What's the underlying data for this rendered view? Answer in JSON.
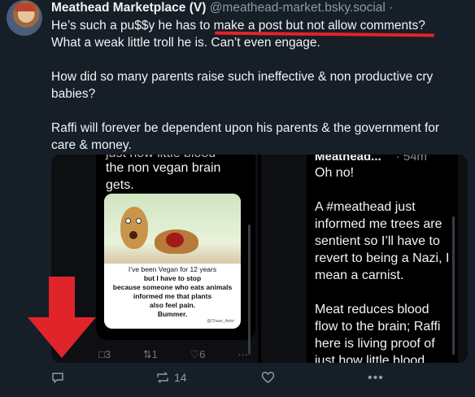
{
  "post": {
    "author_name": "Meathead Marketplace (V)",
    "author_handle": "@meathead-market.bsky.social",
    "separator": "·",
    "text_line1_a": "He’s such a pu$$y he has to ",
    "text_line1_b": "make a post but not allow comments",
    "text_line1_c": "?",
    "text_line2": "What a weak little troll he is. Can’t even engage.",
    "text_para2": "How did so many parents raise such ineffective & non productive cry babies?",
    "text_para3": "Raffi will forever be dependent upon his parents & the government for care & money."
  },
  "images": {
    "left": {
      "top_partial": "just how little blood",
      "line1": "the non vegan brain",
      "line2": "gets.",
      "card_caption1": "I’ve been Vegan for 12 years",
      "card_caption2": "but I have to stop",
      "card_caption3": "because someone who eats animals",
      "card_caption4": "informed me that plants",
      "card_caption5": "also feel pain.",
      "card_caption6": "Bummer.",
      "card_credit": "@Chase_Avior",
      "actions": {
        "reply_count": "3",
        "repost_count": "1",
        "like_count": "6",
        "more": "···"
      }
    },
    "right": {
      "name": "Meathead...",
      "time": "· 54m",
      "p1": "Oh no!",
      "p2": "A #meathead just informed me trees are sentient so I’ll have to revert to being a Nazi, I mean a carnist.",
      "p3": "Meat reduces blood flow to the brain; Raffi here is living proof of just how little blood"
    }
  },
  "actions": {
    "reply_count": "",
    "repost_count": "14",
    "like_count": "",
    "more": "•••"
  },
  "colors": {
    "background": "#161e27",
    "muted": "#8c9aab",
    "annotation_red": "#e0252a"
  }
}
